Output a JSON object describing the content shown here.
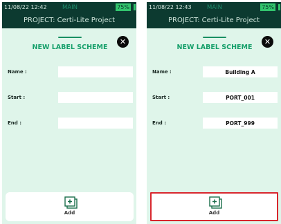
{
  "screens": [
    {
      "status": {
        "time": "11/08/22 12:42",
        "mode": "MAIN",
        "battery": "75%"
      },
      "project_label": "PROJECT: Certi-Lite Project",
      "title": "NEW LABEL SCHEME",
      "fields": [
        {
          "label": "Name :",
          "value": ""
        },
        {
          "label": "Start :",
          "value": ""
        },
        {
          "label": "End :",
          "value": ""
        }
      ],
      "add_label": "Add",
      "add_highlighted": false
    },
    {
      "status": {
        "time": "11/08/22 12:43",
        "mode": "MAIN",
        "battery": "75%"
      },
      "project_label": "PROJECT: Certi-Lite Project",
      "title": "NEW LABEL SCHEME",
      "fields": [
        {
          "label": "Name :",
          "value": "Building A"
        },
        {
          "label": "Start :",
          "value": "PORT_001"
        },
        {
          "label": "End :",
          "value": "PORT_999"
        }
      ],
      "add_label": "Add",
      "add_highlighted": true
    }
  ],
  "colors": {
    "header_bg": "#0c3a30",
    "sheet_bg": "#dff5ea",
    "accent_green": "#159f6a",
    "battery_green": "#32c56d",
    "highlight_red": "#d8262d"
  },
  "icons": {
    "close": "close-icon",
    "add": "add-icon"
  }
}
